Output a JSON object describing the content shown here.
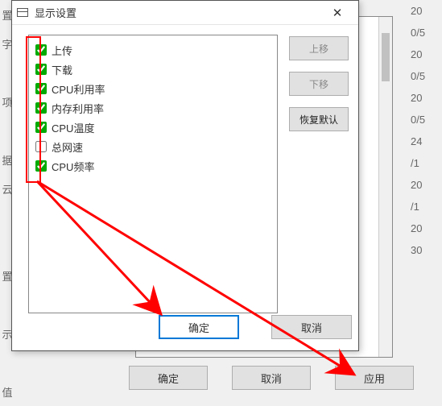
{
  "bg": {
    "buttons": {
      "ok": "确定",
      "cancel": "取消",
      "apply": "应用"
    },
    "left_edge": [
      "置",
      "字",
      "",
      "项",
      "",
      "据",
      "云",
      "",
      "",
      "置",
      "",
      "示",
      "",
      "值"
    ],
    "right_values": [
      "20",
      "0/5",
      "20",
      "0/5",
      "20",
      "0/5",
      "24",
      "/1",
      "20",
      "/1",
      "20",
      "30"
    ]
  },
  "dialog": {
    "title": "显示设置",
    "close_glyph": "✕",
    "items": [
      {
        "label": "上传",
        "checked": true
      },
      {
        "label": "下载",
        "checked": true
      },
      {
        "label": "CPU利用率",
        "checked": true
      },
      {
        "label": "内存利用率",
        "checked": true
      },
      {
        "label": "CPU温度",
        "checked": true
      },
      {
        "label": "总网速",
        "checked": false
      },
      {
        "label": "CPU频率",
        "checked": true
      }
    ],
    "side": {
      "move_up": "上移",
      "move_down": "下移",
      "restore": "恢复默认"
    },
    "bottom": {
      "ok": "确定",
      "cancel": "取消"
    }
  }
}
